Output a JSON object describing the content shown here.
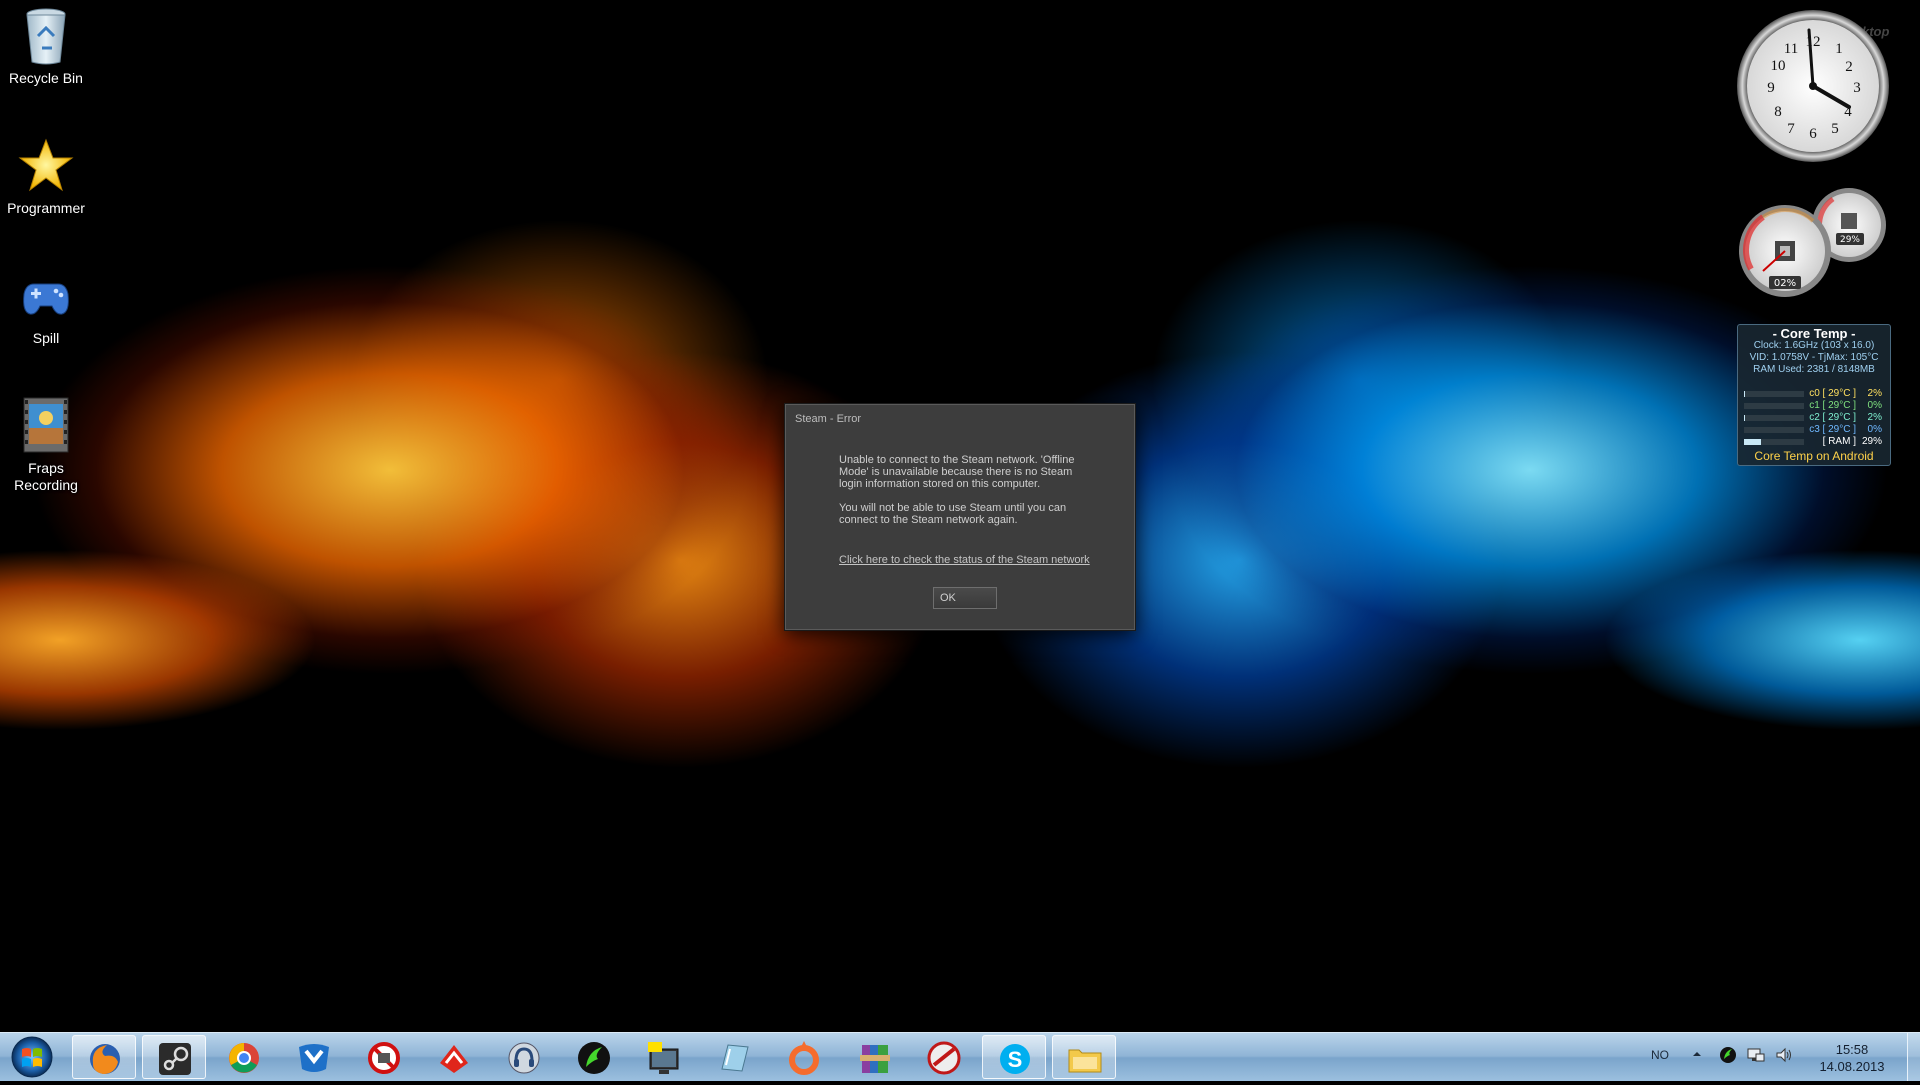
{
  "desktop": {
    "icons": [
      {
        "label": "Recycle Bin"
      },
      {
        "label": "Programmer"
      },
      {
        "label": "Spill"
      },
      {
        "label": "Fraps Recording"
      }
    ]
  },
  "dialog": {
    "title": "Steam - Error",
    "message1": "Unable to connect to the Steam network. 'Offline Mode' is unavailable because there is no Steam login information stored on this computer.",
    "message2": "You will not be able to use Steam until you can connect to the Steam network again.",
    "link": "Click here to check the status of the Steam network",
    "ok_label": "OK"
  },
  "gadgets": {
    "watermark": "ktop",
    "clock": {
      "numbers": [
        "12",
        "1",
        "2",
        "3",
        "4",
        "5",
        "6",
        "7",
        "8",
        "9",
        "10",
        "11"
      ]
    },
    "meters": {
      "cpu_pct": "02%",
      "ram_pct": "29%"
    },
    "coretemp": {
      "title": "- Core Temp -",
      "clock_line": "Clock: 1.6GHz (103 x 16.0)",
      "vid_line": "VID: 1.0758V - TjMax: 105°C",
      "ram_line": "RAM Used: 2381 / 8148MB",
      "rows": [
        {
          "label": "c0 [ 29°C ]",
          "pct": "2%",
          "value": 2
        },
        {
          "label": "c1 [ 29°C ]",
          "pct": "0%",
          "value": 0
        },
        {
          "label": "c2 [ 29°C ]",
          "pct": "2%",
          "value": 2
        },
        {
          "label": "c3 [ 29°C ]",
          "pct": "0%",
          "value": 0
        },
        {
          "label": "[ RAM ]",
          "pct": "29%",
          "value": 29
        }
      ],
      "footer": "Core Temp on Android"
    }
  },
  "taskbar": {
    "pinned": [
      "firefox-icon",
      "steam-icon",
      "chrome-icon",
      "malwarebytes-icon",
      "blocker-icon",
      "ccleaner-icon",
      "teamspeak-icon",
      "razer-icon",
      "fraps-icon",
      "notepad-icon",
      "origin-icon",
      "winrar-icon",
      "game-booster-icon",
      "skype-icon",
      "explorer-icon"
    ],
    "language": "NO",
    "time": "15:58",
    "date": "14.08.2013"
  }
}
